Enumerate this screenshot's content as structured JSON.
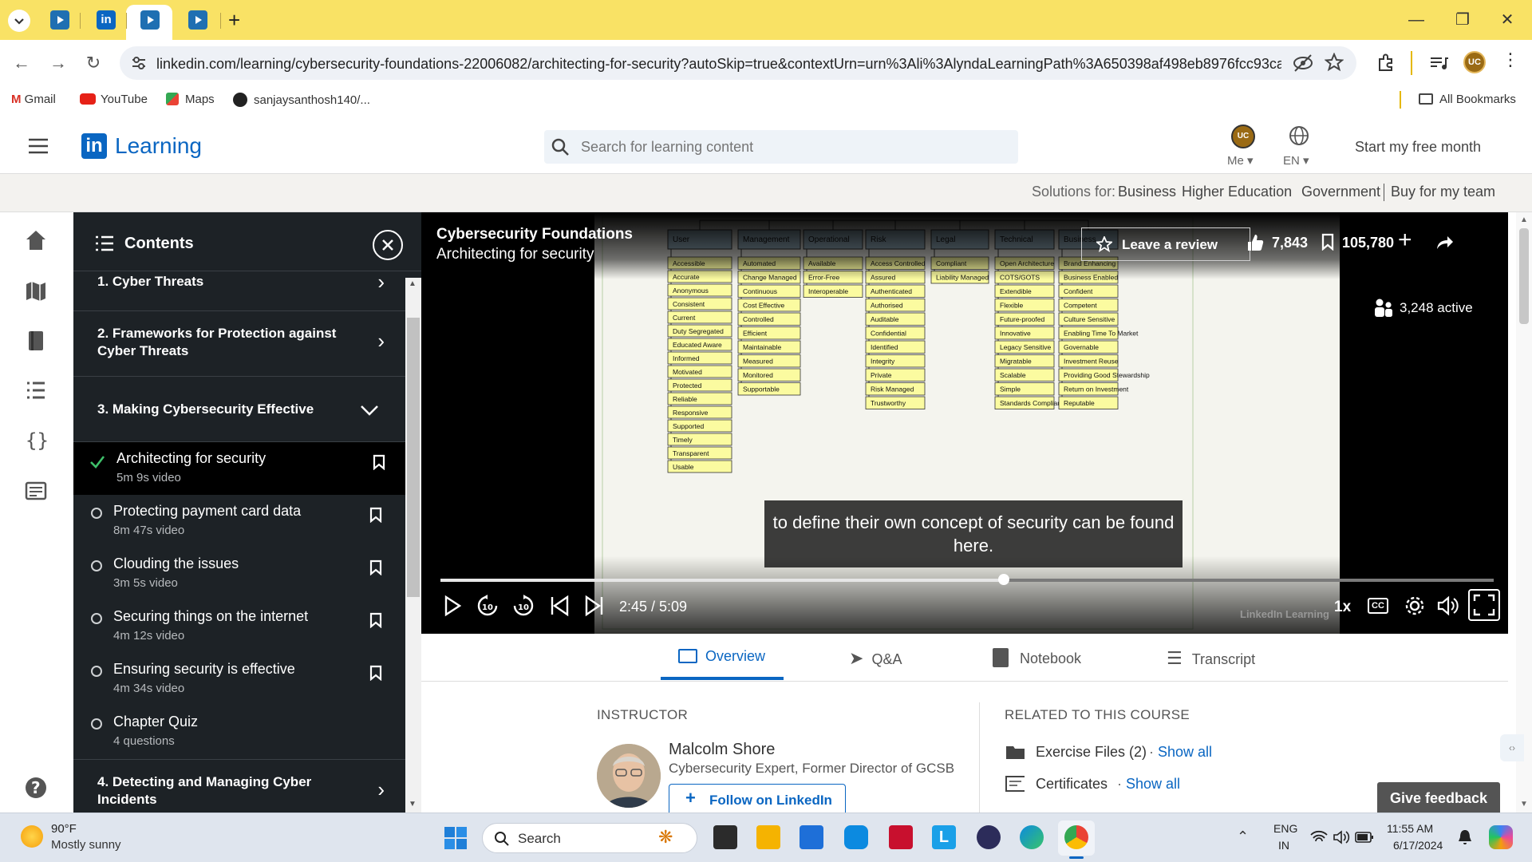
{
  "browser": {
    "tabs": [
      {
        "icon": "youtube-tab-icon",
        "active": false
      },
      {
        "icon": "linkedin-tab-icon",
        "active": false
      },
      {
        "icon": "video-tab-icon",
        "active": true
      },
      {
        "icon": "video-tab-icon",
        "active": false
      }
    ],
    "new_tab_label": "+",
    "url": "linkedin.com/learning/cybersecurity-foundations-22006082/architecting-for-security?autoSkip=true&contextUrn=urn%3Ali%3AlyndaLearningPath%3A650398af498eb8976fcc93ca&r...",
    "bookmarks": [
      {
        "label": "Gmail",
        "icon": "gmail-icon"
      },
      {
        "label": "YouTube",
        "icon": "youtube-icon"
      },
      {
        "label": "Maps",
        "icon": "maps-icon"
      },
      {
        "label": "sanjaysanthosh140/...",
        "icon": "github-icon"
      }
    ],
    "all_bookmarks": "All Bookmarks",
    "profile_initials": "UC"
  },
  "header": {
    "logo_in": "in",
    "logo_text": "Learning",
    "search_placeholder": "Search for learning content",
    "me_label": "Me",
    "lang_label": "EN",
    "cta": "Start my free month"
  },
  "solutions": {
    "prefix": "Solutions for:",
    "links": [
      "Business",
      "Higher Education",
      "Government"
    ],
    "buy": "Buy for my team"
  },
  "contents": {
    "title": "Contents",
    "sections": [
      {
        "title": "1. Cyber Threats",
        "expanded": false
      },
      {
        "title": "2. Frameworks for Protection against Cyber Threats",
        "expanded": false
      },
      {
        "title": "3. Making Cybersecurity Effective",
        "expanded": true
      },
      {
        "title": "4. Detecting and Managing Cyber Incidents",
        "expanded": false
      }
    ],
    "items": [
      {
        "title": "Architecting for security",
        "sub": "5m 9s video",
        "done": true,
        "current": true
      },
      {
        "title": "Protecting payment card data",
        "sub": "8m 47s video",
        "done": false
      },
      {
        "title": "Clouding the issues",
        "sub": "3m 5s video",
        "done": false
      },
      {
        "title": "Securing things on the internet",
        "sub": "4m 12s video",
        "done": false
      },
      {
        "title": "Ensuring security is effective",
        "sub": "4m 34s video",
        "done": false
      },
      {
        "title": "Chapter Quiz",
        "sub": "4 questions",
        "done": false
      }
    ]
  },
  "player": {
    "course_title": "Cybersecurity Foundations",
    "video_title": "Architecting for security",
    "review_label": "Leave a review",
    "likes": "7,843",
    "saves": "105,780",
    "active": "3,248 active",
    "caption": "to define their own concept of security can be found here.",
    "time": "2:45 / 5:09",
    "progress": 0.535,
    "speed": "1x",
    "cc": "CC",
    "watermark": "LinkedIn Learning"
  },
  "slide": {
    "columns": [
      {
        "head": "User",
        "items": [
          "Accessible",
          "Accurate",
          "Anonymous",
          "Consistent",
          "Current",
          "Duty Segregated",
          "Educated Aware",
          "Informed",
          "Motivated",
          "Protected",
          "Reliable",
          "Responsive",
          "Supported",
          "Timely",
          "Transparent",
          "Usable"
        ]
      },
      {
        "head": "Management",
        "items": [
          "Automated",
          "Change Managed",
          "Continuous",
          "Cost Effective",
          "Controlled",
          "Efficient",
          "Maintainable",
          "Measured",
          "Monitored",
          "Supportable"
        ]
      },
      {
        "head": "Operational",
        "items": [
          "Available",
          "Error-Free",
          "Interoperable"
        ]
      },
      {
        "head": "Risk",
        "items": [
          "Access Controlled",
          "Assured",
          "Authenticated",
          "Authorised",
          "Auditable",
          "Confidential",
          "Identified",
          "Integrity",
          "Private",
          "Risk Managed",
          "Trustworthy"
        ]
      },
      {
        "head": "Legal",
        "items": [
          "Compliant",
          "Liability Managed"
        ]
      },
      {
        "head": "Technical",
        "items": [
          "Open Architecture",
          "COTS/GOTS",
          "Extendible",
          "Flexible",
          "Future-proofed",
          "Innovative",
          "Legacy Sensitive",
          "Migratable",
          "Scalable",
          "Simple",
          "Standards Compliant"
        ]
      },
      {
        "head": "Business",
        "items": [
          "Brand Enhancing",
          "Business Enabled",
          "Confident",
          "Competent",
          "Culture Sensitive",
          "Enabling Time To Market",
          "Governable",
          "Investment Reuse",
          "Providing Good Stewardship",
          "Return on Investment",
          "Reputable"
        ]
      }
    ]
  },
  "tabs": [
    {
      "label": "Overview",
      "active": true
    },
    {
      "label": "Q&A",
      "active": false
    },
    {
      "label": "Notebook",
      "active": false
    },
    {
      "label": "Transcript",
      "active": false
    }
  ],
  "overview": {
    "instructor_heading": "INSTRUCTOR",
    "instructor_name": "Malcolm Shore",
    "instructor_title": "Cybersecurity Expert, Former Director of GCSB",
    "follow_label": "Follow on LinkedIn",
    "related_heading": "RELATED TO THIS COURSE",
    "related": [
      {
        "label": "Exercise Files (2)",
        "link": "Show all",
        "icon": "folder-icon"
      },
      {
        "label": "Certificates",
        "link": "Show all",
        "icon": "certificate-icon"
      }
    ],
    "feedback": "Give feedback"
  },
  "taskbar": {
    "weather_temp": "90°F",
    "weather_desc": "Mostly sunny",
    "search": "Search",
    "lang_top": "ENG",
    "lang_bot": "IN",
    "time": "11:55 AM",
    "date": "6/17/2024"
  },
  "colors": {
    "browser_bar": "#f9e265",
    "linkedin_blue": "#0a66c2",
    "panel_bg": "#1d2226",
    "sticky_note": "#fbfba0",
    "sticky_head": "#a9c6d7"
  }
}
